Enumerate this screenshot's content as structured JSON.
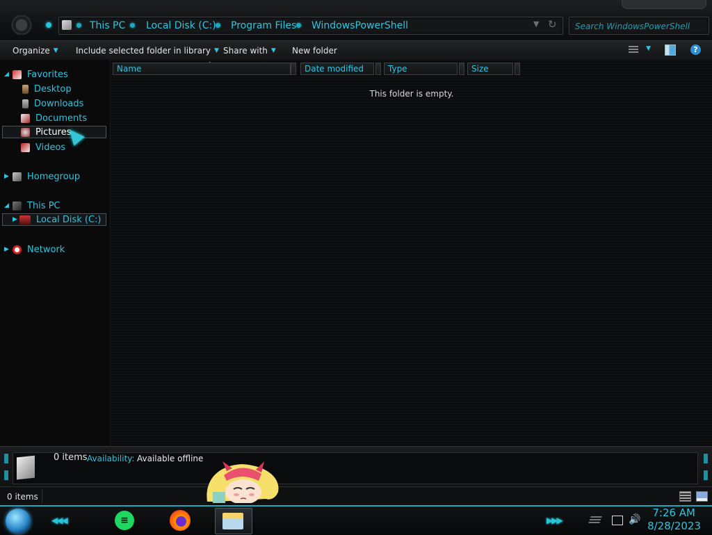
{
  "address": {
    "crumbs": [
      "This PC",
      "Local Disk (C:)",
      "Program Files",
      "WindowsPowerShell"
    ]
  },
  "search": {
    "placeholder": "Search WindowsPowerShell"
  },
  "toolbar": {
    "organize": "Organize",
    "include_in_library": "Include selected folder in library",
    "share_with": "Share with",
    "new_folder": "New folder",
    "help": "?"
  },
  "nav": {
    "favorites": "Favorites",
    "desktop": "Desktop",
    "downloads": "Downloads",
    "documents": "Documents",
    "pictures": "Pictures",
    "videos": "Videos",
    "homegroup": "Homegroup",
    "this_pc": "This PC",
    "local_disk": "Local Disk (C:)",
    "network": "Network"
  },
  "columns": {
    "name": "Name",
    "date_modified": "Date modified",
    "type": "Type",
    "size": "Size"
  },
  "content": {
    "empty_message": "This folder is empty."
  },
  "details": {
    "items": "0 items",
    "availability_label": "Availability:",
    "availability_value": "Available offline"
  },
  "status": {
    "items": "0 items"
  },
  "taskbar": {
    "spotify_glyph": "≡",
    "time": "7:26 AM",
    "date": "8/28/2023"
  },
  "colors": {
    "accent": "#2ec5e0",
    "background": "#0b0b0c"
  }
}
